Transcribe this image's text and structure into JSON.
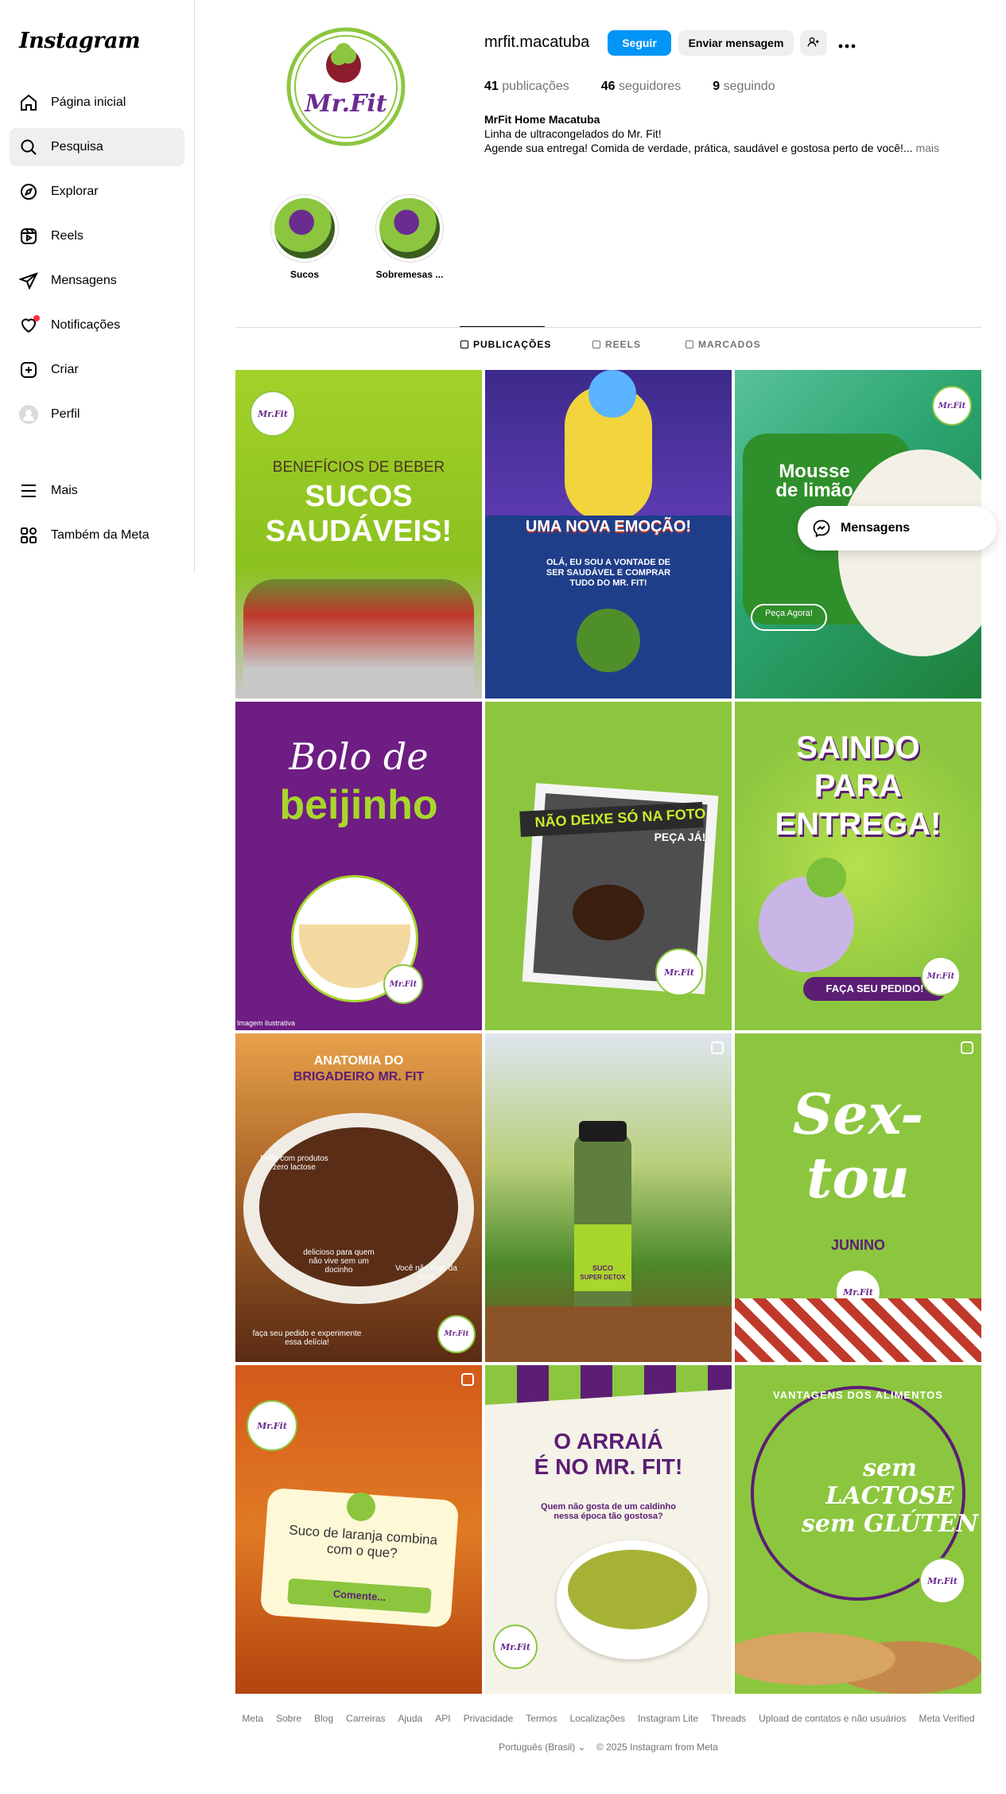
{
  "app": {
    "logo": "Instagram"
  },
  "sidebar": {
    "items": [
      {
        "label": "Página inicial",
        "icon": "home-icon"
      },
      {
        "label": "Pesquisa",
        "icon": "search-icon",
        "active": true
      },
      {
        "label": "Explorar",
        "icon": "compass-icon"
      },
      {
        "label": "Reels",
        "icon": "reels-icon"
      },
      {
        "label": "Mensagens",
        "icon": "send-icon"
      },
      {
        "label": "Notificações",
        "icon": "heart-icon"
      },
      {
        "label": "Criar",
        "icon": "plus-square-icon"
      },
      {
        "label": "Perfil",
        "icon": "avatar-icon"
      }
    ],
    "bottom": [
      {
        "label": "Mais",
        "icon": "menu-icon"
      },
      {
        "label": "Também da Meta",
        "icon": "meta-apps-icon"
      }
    ]
  },
  "profile": {
    "avatar_text": "Mr.Fit",
    "username": "mrfit.macatuba",
    "follow_label": "Seguir",
    "message_label": "Enviar mensagem",
    "stats": {
      "posts_count": "41",
      "posts_label": "publicações",
      "followers_count": "46",
      "followers_label": "seguidores",
      "following_count": "9",
      "following_label": "seguindo"
    },
    "bio": {
      "name": "MrFit Home Macatuba",
      "line1": "Linha de ultracongelados do Mr. Fit!",
      "line2": "Agende sua entrega! Comida de verdade, prática, saudável e gostosa perto de você!...",
      "more": "mais"
    }
  },
  "highlights": [
    {
      "label": "Sucos"
    },
    {
      "label": "Sobremesas ..."
    }
  ],
  "tabs": [
    {
      "label": "PUBLICAÇÕES",
      "active": true
    },
    {
      "label": "REELS"
    },
    {
      "label": "MARCADOS"
    }
  ],
  "posts": [
    {
      "line1": "BENEFÍCIOS DE BEBER",
      "line2": "SUCOS",
      "line3": "SAUDÁVEIS!"
    },
    {
      "line1": "UMA NOVA EMOÇÃO!",
      "line2": "OLÁ, EU SOU A VONTADE DE SER SAUDÁVEL E COMPRAR TUDO DO MR. FIT!"
    },
    {
      "line1": "Mousse",
      "line2": "de limão",
      "line3": "Peça Agora!"
    },
    {
      "line1": "Bolo de",
      "line2": "beijinho",
      "line3": "Imagem ilustrativa"
    },
    {
      "line1": "NÃO DEIXE SÓ NA FOTO",
      "line2": "PEÇA JÁ!"
    },
    {
      "line1": "SAINDO",
      "line2": "PARA",
      "line3": "ENTREGA!",
      "line4": "FAÇA SEU PEDIDO!"
    },
    {
      "line1": "ANATOMIA DO",
      "line2": "BRIGADEIRO MR. FIT",
      "line3": "Feito com produtos zero lactose",
      "line4": "delicioso para quem não vive sem um docinho",
      "line5": "Você não foge da dieta",
      "line6": "faça seu pedido e experimente essa delícia!"
    },
    {
      "line1": "SUCO",
      "line2": "SUPER DETOX"
    },
    {
      "line1": "Sex-",
      "line2": "tou",
      "line3": "JUNINO"
    },
    {
      "line1": "Suco de laranja combina com o que?",
      "line2": "Comente..."
    },
    {
      "line1": "O ARRAIÁ",
      "line2": "É NO MR. FIT!",
      "line3": "Quem não gosta de um caldinho nessa época tão gostosa?"
    },
    {
      "line1": "VANTAGENS DOS ALIMENTOS",
      "line2": "sem LACTOSE",
      "line3": "sem GLÚTEN"
    }
  ],
  "floating": {
    "messages_label": "Mensagens"
  },
  "footer": {
    "links": [
      "Meta",
      "Sobre",
      "Blog",
      "Carreiras",
      "Ajuda",
      "API",
      "Privacidade",
      "Termos",
      "Localizações",
      "Instagram Lite",
      "Threads",
      "Upload de contatos e não usuários",
      "Meta Verified"
    ],
    "language": "Português (Brasil)",
    "copyright": "© 2025 Instagram from Meta"
  },
  "colors": {
    "accent": "#0095f6",
    "brand_green": "#8cc63f",
    "brand_purple": "#6b2c91"
  }
}
